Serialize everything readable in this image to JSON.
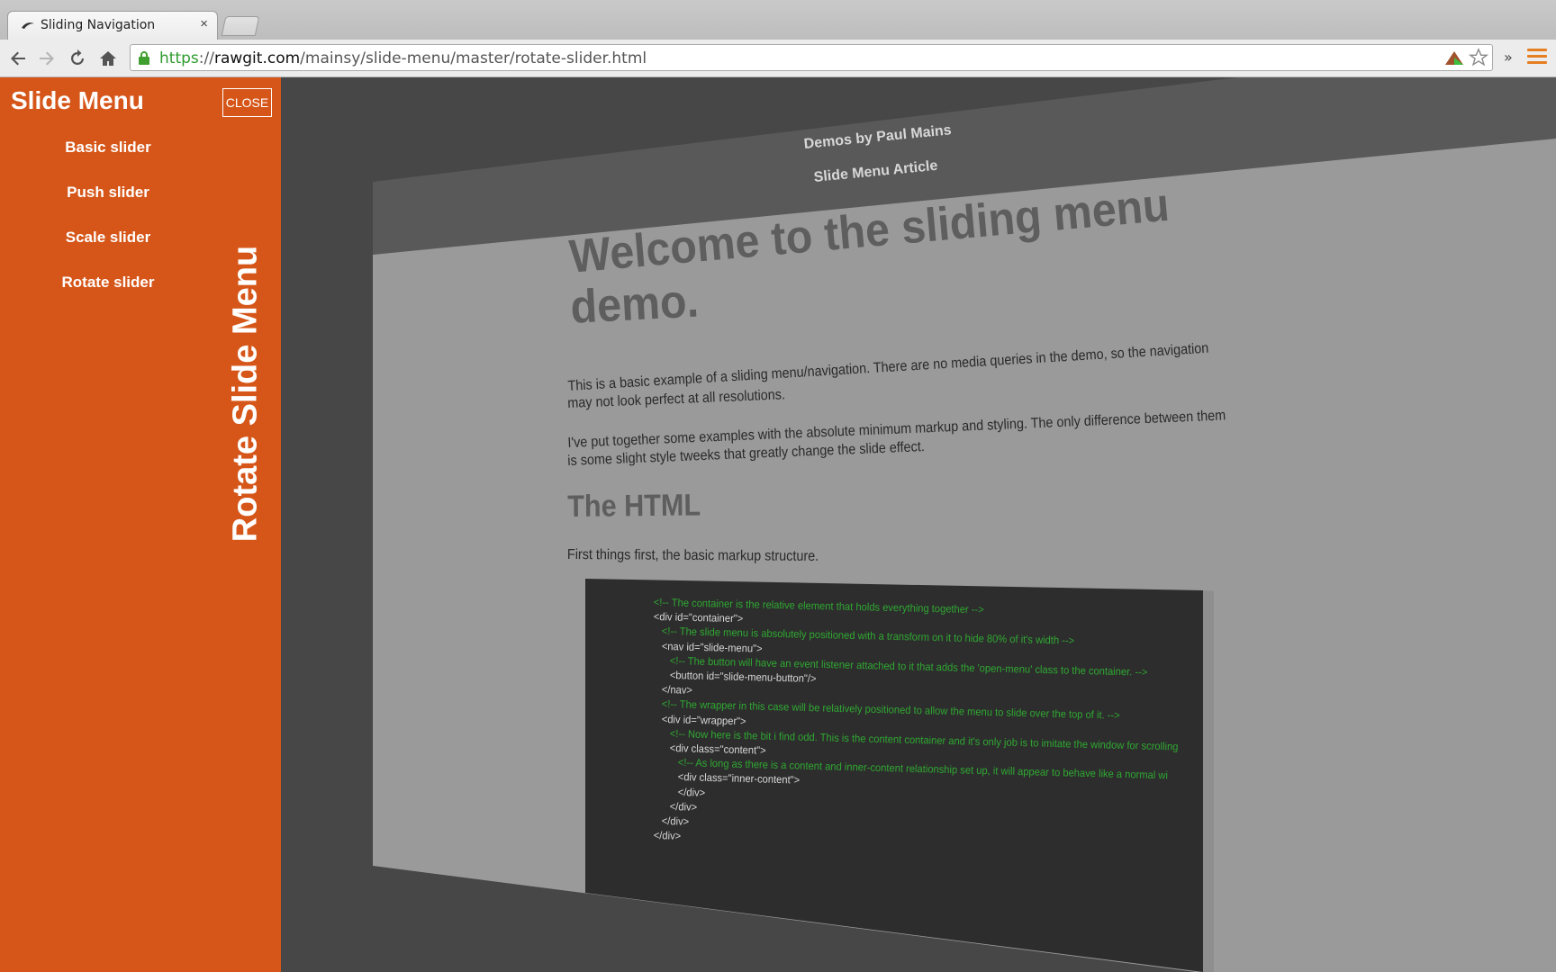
{
  "browser": {
    "tab_title": "Sliding Navigation",
    "tab_close": "×",
    "url_scheme": "https",
    "url_sep": "://",
    "url_host": "rawgit.com",
    "url_path": "/mainsy/slide-menu/master/rotate-slider.html",
    "overflow": "»"
  },
  "menu": {
    "title": "Slide Menu",
    "close_label": "CLOSE",
    "items": [
      "Basic slider",
      "Push slider",
      "Scale slider",
      "Rotate slider"
    ],
    "vertical_label": "Rotate Slide Menu",
    "background": "#d65619"
  },
  "page": {
    "header_links": [
      "Demos by Paul Mains",
      "Slide Menu Article"
    ],
    "heading_line1": "Welcome to the sliding menu",
    "heading_line2": "demo.",
    "para1_line1": "This is a basic example of a sliding menu/navigation. There are no media queries in the demo, so the navigation",
    "para1_line2": "may not look perfect at all resolutions.",
    "para2_line1": "I've put together some examples with the absolute minimum markup and styling. The only difference between them",
    "para2_line2": "is some slight style tweeks that greatly change the slide effect.",
    "subheading": "The HTML",
    "para3": "First things first, the basic markup structure.",
    "code_lines": [
      "<!-- The container is the relative element that holds everything together -->",
      "<div id=\"container\">",
      "<!-- The slide menu is absolutely positioned with a transform on it to hide 80% of it's width -->",
      "<nav id=\"slide-menu\">",
      "<!-- The button will have an event listener attached to it that adds the 'open-menu' class to the container. -->",
      "<button id=\"slide-menu-button\"/>",
      "</nav>",
      "<!-- The wrapper in this case will be relatively positioned to allow the menu to slide over the top of it. -->",
      "<div id=\"wrapper\">",
      "<!-- Now here is the bit i find odd. This is the content container and it's only job is to imitate the window for scrolling",
      "<div class=\"content\">",
      "<!-- As long as there is a content and inner-content relationship set up, it will appear to behave like a normal wi",
      "<div class=\"inner-content\">",
      "</div>",
      "</div>",
      "</div>",
      "</div>"
    ]
  }
}
